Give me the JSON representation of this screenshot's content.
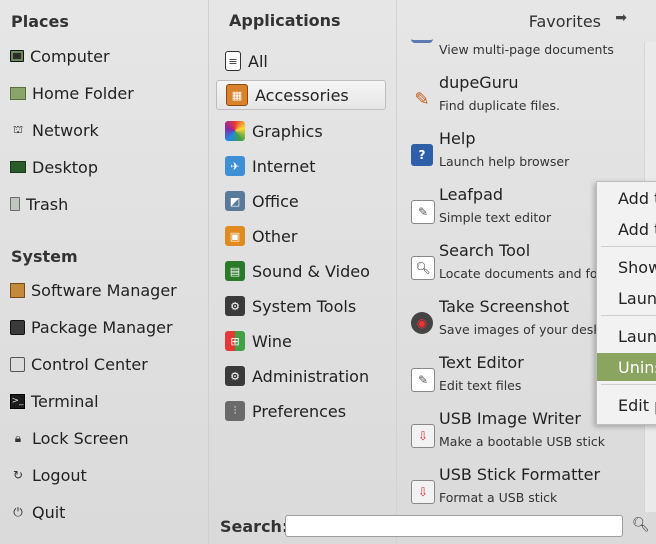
{
  "places": {
    "title": "Places",
    "items": [
      {
        "label": "Computer",
        "icon": "computer-icon"
      },
      {
        "label": "Home Folder",
        "icon": "home-folder-icon"
      },
      {
        "label": "Network",
        "icon": "network-icon"
      },
      {
        "label": "Desktop",
        "icon": "desktop-icon"
      },
      {
        "label": "Trash",
        "icon": "trash-icon"
      }
    ]
  },
  "system": {
    "title": "System",
    "items": [
      {
        "label": "Software Manager",
        "icon": "software-manager-icon"
      },
      {
        "label": "Package Manager",
        "icon": "package-manager-icon"
      },
      {
        "label": "Control Center",
        "icon": "control-center-icon"
      },
      {
        "label": "Terminal",
        "icon": "terminal-icon"
      },
      {
        "label": "Lock Screen",
        "icon": "lock-icon"
      },
      {
        "label": "Logout",
        "icon": "logout-icon"
      },
      {
        "label": "Quit",
        "icon": "power-icon"
      }
    ]
  },
  "categories": {
    "title": "Applications",
    "items": [
      {
        "label": "All",
        "icon": "all-icon"
      },
      {
        "label": "Accessories",
        "icon": "accessories-icon",
        "selected": true
      },
      {
        "label": "Graphics",
        "icon": "graphics-icon"
      },
      {
        "label": "Internet",
        "icon": "internet-icon"
      },
      {
        "label": "Office",
        "icon": "office-icon"
      },
      {
        "label": "Other",
        "icon": "other-icon"
      },
      {
        "label": "Sound & Video",
        "icon": "sound-video-icon"
      },
      {
        "label": "System Tools",
        "icon": "system-tools-icon"
      },
      {
        "label": "Wine",
        "icon": "wine-icon"
      },
      {
        "label": "Administration",
        "icon": "administration-icon"
      },
      {
        "label": "Preferences",
        "icon": "preferences-icon"
      }
    ]
  },
  "favorites": {
    "label": "Favorites"
  },
  "apps": {
    "partial_desc": "View multi-page documents",
    "items": [
      {
        "name": "dupeGuru",
        "desc": "Find duplicate files.",
        "icon": "dupeguru-icon"
      },
      {
        "name": "Help",
        "desc": "Launch help browser",
        "icon": "help-icon"
      },
      {
        "name": "Leafpad",
        "desc": "Simple text editor",
        "icon": "leafpad-icon"
      },
      {
        "name": "Search Tool",
        "desc": "Locate documents and folders",
        "icon": "search-tool-icon"
      },
      {
        "name": "Take Screenshot",
        "desc": "Save images of your desktop",
        "icon": "screenshot-icon"
      },
      {
        "name": "Text Editor",
        "desc": "Edit text files",
        "icon": "text-editor-icon"
      },
      {
        "name": "USB Image Writer",
        "desc": "Make a bootable USB stick",
        "icon": "usb-writer-icon"
      },
      {
        "name": "USB Stick Formatter",
        "desc": "Format a USB stick",
        "icon": "usb-formatter-icon"
      }
    ]
  },
  "context_menu": {
    "items": [
      "Add t",
      "Add t",
      "Show",
      "Laun",
      "Laun",
      "Unins",
      "Edit p"
    ],
    "highlighted_index": 5
  },
  "search": {
    "label": "Search:",
    "value": "",
    "placeholder": ""
  },
  "colors": {
    "highlight": "#8aa55f",
    "panel": "#e2e2e2"
  }
}
